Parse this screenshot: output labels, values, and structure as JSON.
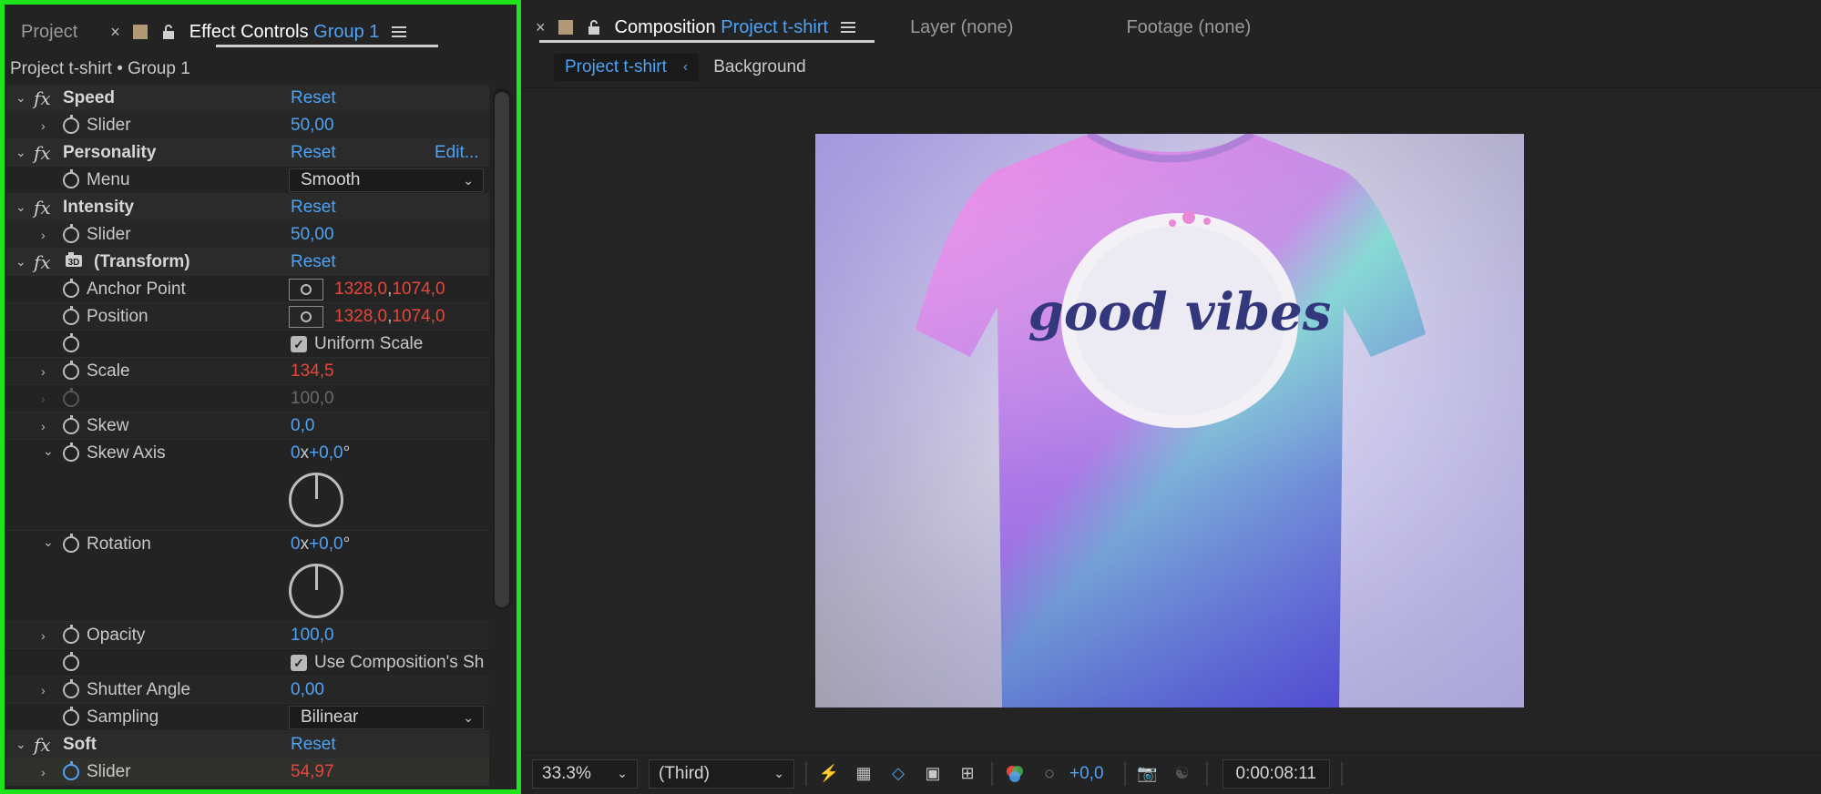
{
  "left_panel": {
    "tab_project": "Project",
    "tab_effect_controls": "Effect Controls",
    "tab_effect_target": "Group 1",
    "breadcrumb": "Project t-shirt • Group 1",
    "reset_label": "Reset",
    "edit_label": "Edit...",
    "effects": {
      "speed": {
        "name": "Speed",
        "slider_label": "Slider",
        "slider_value": "50,00"
      },
      "personality": {
        "name": "Personality",
        "menu_label": "Menu",
        "menu_value": "Smooth"
      },
      "intensity": {
        "name": "Intensity",
        "slider_label": "Slider",
        "slider_value": "50,00"
      },
      "transform": {
        "name": "(Transform)",
        "anchor_label": "Anchor Point",
        "anchor_x": "1328,0",
        "anchor_y": "1074,0",
        "position_label": "Position",
        "position_x": "1328,0",
        "position_y": "1074,0",
        "uniform_scale_label": "Uniform Scale",
        "scale_label": "Scale",
        "scale_value": "134,5",
        "scale_disabled_value": "100,0",
        "skew_label": "Skew",
        "skew_value": "0,0",
        "skew_axis_label": "Skew Axis",
        "skew_axis_rev": "0",
        "skew_axis_deg": "+0,0",
        "rotation_label": "Rotation",
        "rotation_rev": "0",
        "rotation_deg": "+0,0",
        "opacity_label": "Opacity",
        "opacity_value": "100,0",
        "use_comp_shutter_label": "Use Composition's Sh",
        "shutter_angle_label": "Shutter Angle",
        "shutter_angle_value": "0,00",
        "sampling_label": "Sampling",
        "sampling_value": "Bilinear"
      },
      "soft": {
        "name": "Soft",
        "slider_label": "Slider",
        "slider_value": "54,97"
      }
    },
    "x_sep": "x",
    "deg_sign": "°",
    "comma": ","
  },
  "right_panel": {
    "tab_composition": "Composition",
    "tab_composition_name": "Project t-shirt",
    "tab_layer": "Layer (none)",
    "tab_footage": "Footage (none)",
    "subtab_active": "Project t-shirt",
    "subtab_other": "Background",
    "artwork_text": "good vibes",
    "bottom": {
      "zoom": "33.3%",
      "view": "(Third)",
      "exposure": "+0,0",
      "timecode": "0:00:08:11"
    }
  },
  "colors": {
    "accent_blue": "#4ea3f5",
    "value_red": "#e5473b",
    "focus_outline": "#1ee51b"
  }
}
